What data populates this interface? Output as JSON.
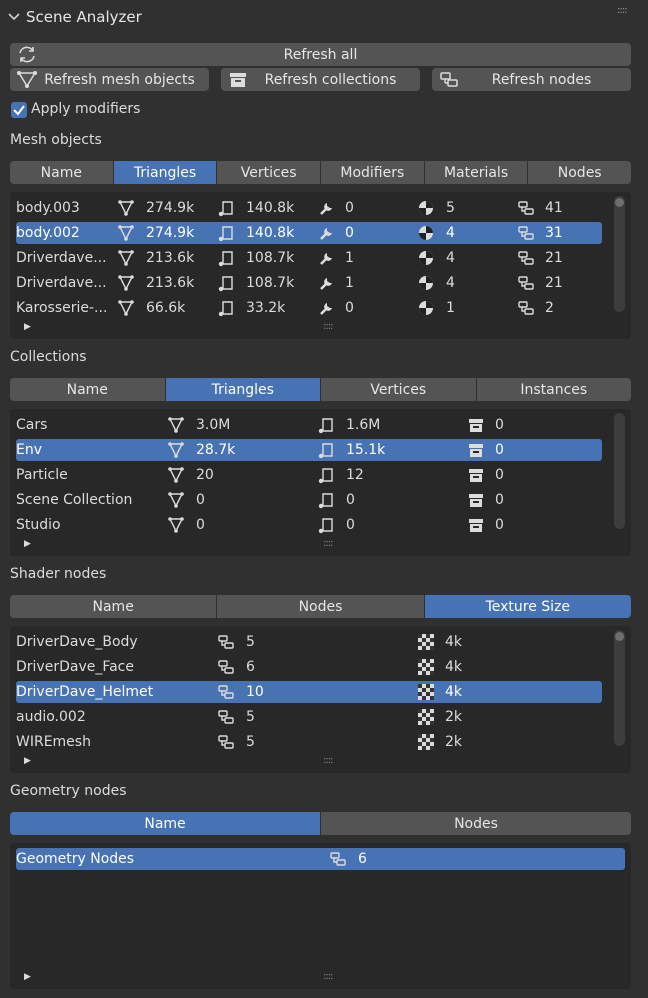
{
  "panel": {
    "title": "Scene Analyzer"
  },
  "toolbar": {
    "refresh_all": "Refresh all",
    "refresh_mesh": "Refresh mesh objects",
    "refresh_collections": "Refresh collections",
    "refresh_nodes": "Refresh nodes",
    "apply_modifiers": "Apply modifiers",
    "apply_modifiers_checked": true
  },
  "mesh": {
    "label": "Mesh objects",
    "tabs": [
      "Name",
      "Triangles",
      "Vertices",
      "Modifiers",
      "Materials",
      "Nodes"
    ],
    "active_tab": 1,
    "rows": [
      {
        "name": "body.003",
        "tris": "274.9k",
        "verts": "140.8k",
        "mods": "0",
        "mats": "5",
        "nodes": "41"
      },
      {
        "name": "body.002",
        "tris": "274.9k",
        "verts": "140.8k",
        "mods": "0",
        "mats": "4",
        "nodes": "31"
      },
      {
        "name": "Driverdave...",
        "tris": "213.6k",
        "verts": "108.7k",
        "mods": "1",
        "mats": "4",
        "nodes": "21"
      },
      {
        "name": "Driverdave...",
        "tris": "213.6k",
        "verts": "108.7k",
        "mods": "1",
        "mats": "4",
        "nodes": "21"
      },
      {
        "name": "Karosserie-...",
        "tris": "66.6k",
        "verts": "33.2k",
        "mods": "0",
        "mats": "1",
        "nodes": "2"
      }
    ],
    "selected": 1
  },
  "collections": {
    "label": "Collections",
    "tabs": [
      "Name",
      "Triangles",
      "Vertices",
      "Instances"
    ],
    "active_tab": 1,
    "rows": [
      {
        "name": "Cars",
        "tris": "3.0M",
        "verts": "1.6M",
        "inst": "0"
      },
      {
        "name": "Env",
        "tris": "28.7k",
        "verts": "15.1k",
        "inst": "0"
      },
      {
        "name": "Particle",
        "tris": "20",
        "verts": "12",
        "inst": "0"
      },
      {
        "name": "Scene Collection",
        "tris": "0",
        "verts": "0",
        "inst": "0"
      },
      {
        "name": "Studio",
        "tris": "0",
        "verts": "0",
        "inst": "0"
      }
    ],
    "selected": 1
  },
  "shader": {
    "label": "Shader nodes",
    "tabs": [
      "Name",
      "Nodes",
      "Texture Size"
    ],
    "active_tab": 2,
    "rows": [
      {
        "name": "DriverDave_Body",
        "nodes": "5",
        "tex": "4k"
      },
      {
        "name": "DriverDave_Face",
        "nodes": "6",
        "tex": "4k"
      },
      {
        "name": "DriverDave_Helmet",
        "nodes": "10",
        "tex": "4k"
      },
      {
        "name": "audio.002",
        "nodes": "5",
        "tex": "2k"
      },
      {
        "name": "WIREmesh",
        "nodes": "5",
        "tex": "2k"
      }
    ],
    "selected": 2
  },
  "geometry": {
    "label": "Geometry nodes",
    "tabs": [
      "Name",
      "Nodes"
    ],
    "active_tab": 0,
    "rows": [
      {
        "name": "Geometry Nodes",
        "nodes": "6"
      }
    ],
    "selected": 0
  },
  "colors": {
    "accent": "#4772b3",
    "panel": "#303030",
    "button": "#545454",
    "list_bg": "#282828"
  }
}
